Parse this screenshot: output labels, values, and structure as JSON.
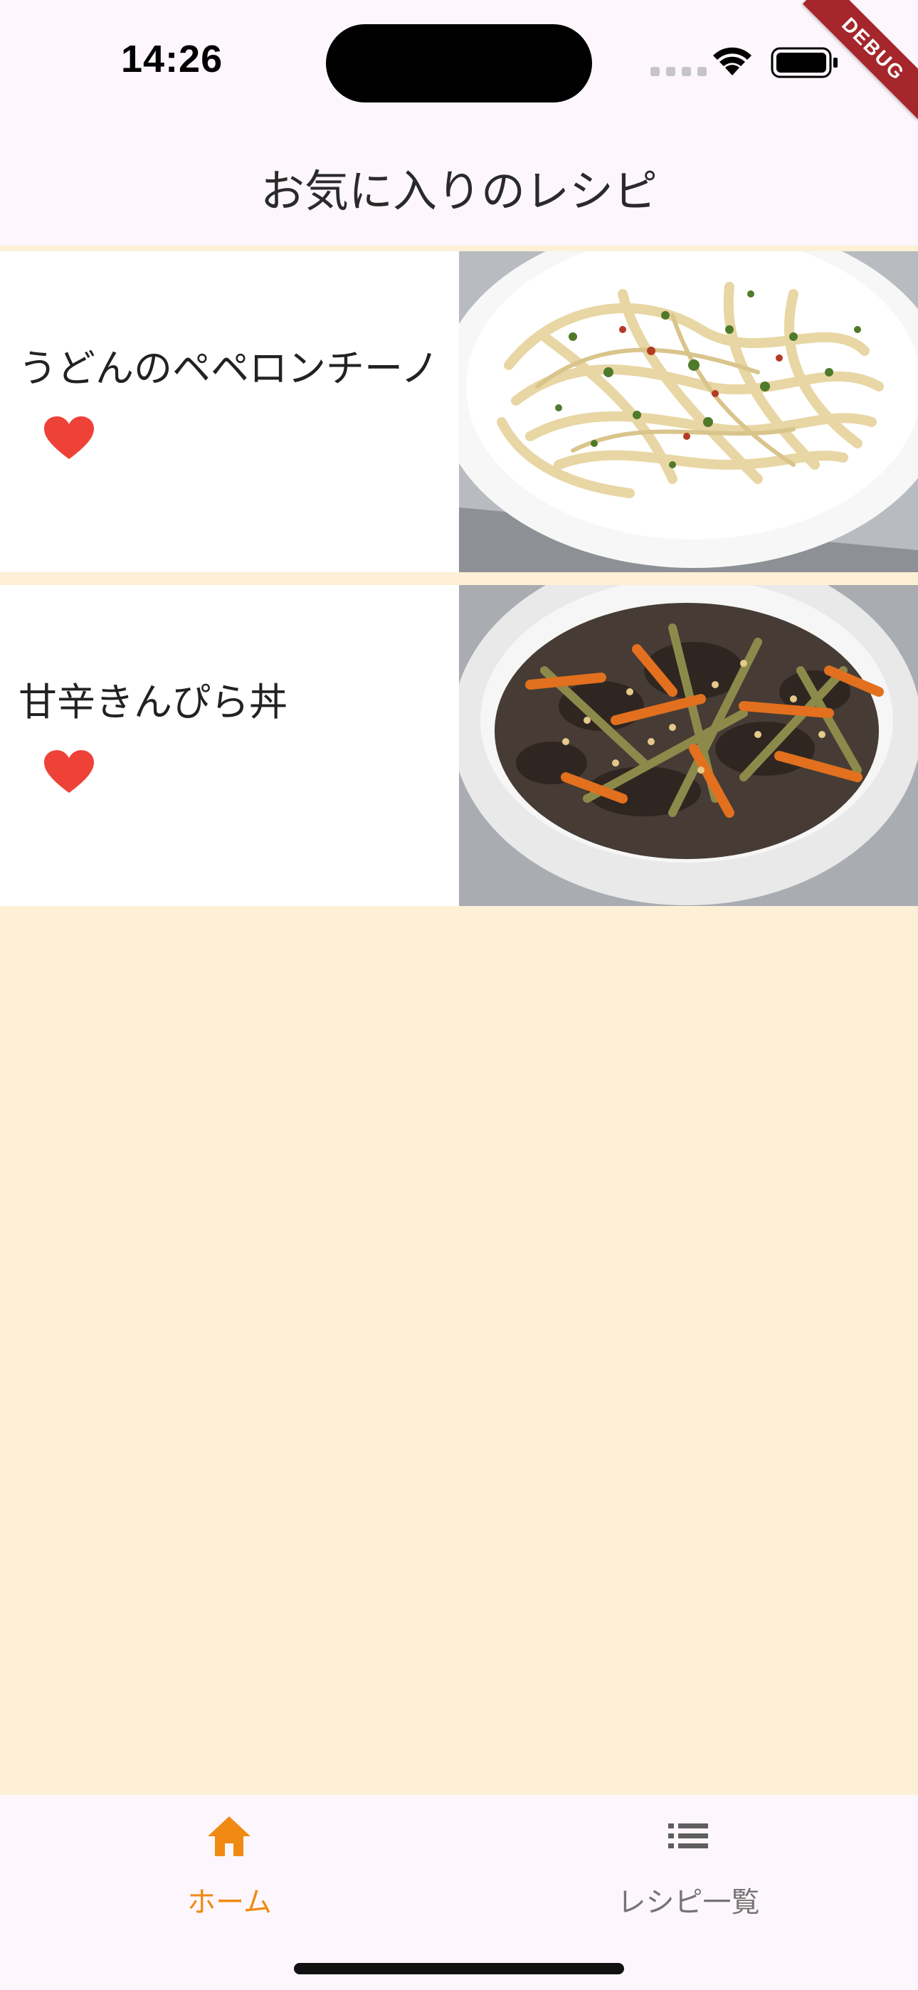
{
  "status_bar": {
    "time": "14:26",
    "debug_banner": "DEBUG"
  },
  "app_bar": {
    "title": "お気に入りのレシピ"
  },
  "recipes": [
    {
      "name": "うどんのペペロンチーノ",
      "favorite": true,
      "photo": "udon-peperoncino-photo"
    },
    {
      "name": "甘辛きんぴら丼",
      "favorite": true,
      "photo": "kinpira-donburi-photo"
    }
  ],
  "bottom_nav": {
    "items": [
      {
        "label": "ホーム",
        "icon": "home-icon",
        "active": true
      },
      {
        "label": "レシピ一覧",
        "icon": "list-icon",
        "active": false
      }
    ]
  },
  "colors": {
    "accent": "#f08a12",
    "heart": "#ee4238",
    "background": "#fdf0d6",
    "bar": "#fdf7fd"
  }
}
